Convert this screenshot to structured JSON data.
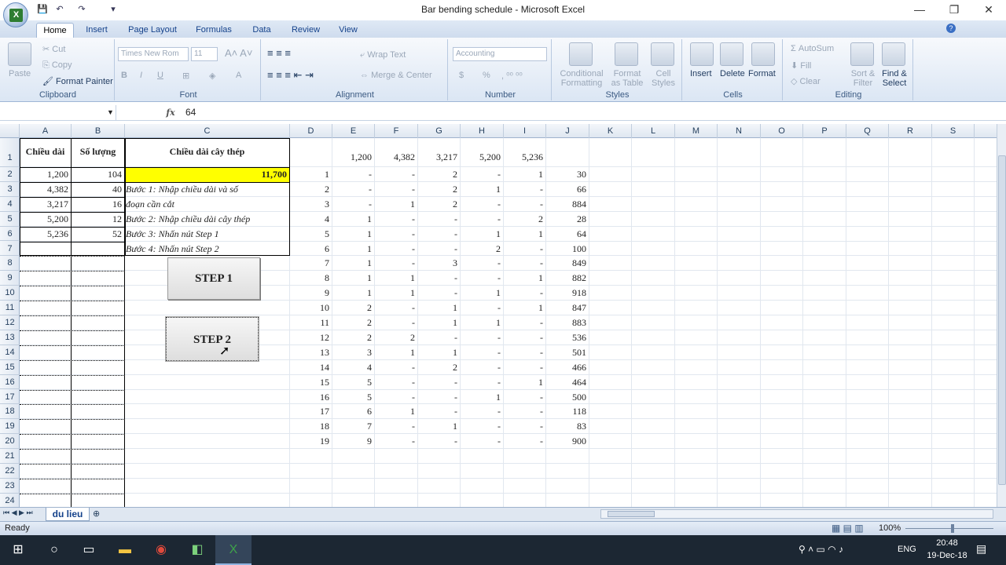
{
  "window": {
    "title": "Bar bending schedule - Microsoft Excel",
    "min": "—",
    "max": "❐",
    "close": "✕"
  },
  "qat": {
    "save": "💾",
    "undo": "↶",
    "redo": "↷",
    "more": "▾"
  },
  "tabs": [
    "Home",
    "Insert",
    "Page Layout",
    "Formulas",
    "Data",
    "Review",
    "View"
  ],
  "ribbon": {
    "clipboard": {
      "label": "Clipboard",
      "paste": "Paste",
      "cut": "Cut",
      "copy": "Copy",
      "format_painter": "Format Painter"
    },
    "font": {
      "label": "Font",
      "family": "Times New Rom",
      "size": "11"
    },
    "alignment": {
      "label": "Alignment",
      "wrap": "Wrap Text",
      "merge": "Merge & Center"
    },
    "number": {
      "label": "Number",
      "format": "Accounting",
      "currency": "$",
      "percent": "%"
    },
    "styles": {
      "label": "Styles",
      "conditional": "Conditional Formatting",
      "table": "Format as Table",
      "cell": "Cell Styles"
    },
    "cells": {
      "label": "Cells",
      "insert": "Insert",
      "delete": "Delete",
      "format": "Format"
    },
    "editing": {
      "label": "Editing",
      "autosum": "AutoSum",
      "fill": "Fill",
      "clear": "Clear",
      "sort": "Sort & Filter",
      "find": "Find & Select"
    }
  },
  "formula": {
    "namebox": "",
    "fx": "fx",
    "value": "64"
  },
  "columns": [
    "A",
    "B",
    "C",
    "D",
    "E",
    "F",
    "G",
    "H",
    "I",
    "J",
    "K",
    "L",
    "M",
    "N",
    "O",
    "P",
    "Q",
    "R",
    "S"
  ],
  "rows": [
    "1",
    "2",
    "3",
    "4",
    "5",
    "6",
    "7",
    "8",
    "9",
    "10",
    "11",
    "12",
    "13",
    "14",
    "15",
    "16",
    "17",
    "18",
    "19",
    "20",
    "21",
    "22",
    "23",
    "24"
  ],
  "left_table": {
    "header": [
      "Chiều dài",
      "Số lượng",
      "Chiều dài cây thép"
    ],
    "lengths": [
      "1,200",
      "4,382",
      "3,217",
      "5,200",
      "5,236"
    ],
    "qty": [
      "104",
      "40",
      "16",
      "12",
      "52"
    ],
    "bar_length": "11,700",
    "steps": [
      "Bước 1: Nhập chiều dài và số",
      "đoạn cần cắt",
      "Bước 2: Nhập chiều dài cây thép",
      "Bước 3: Nhấn nút Step 1",
      "Bước 4: Nhấn nút Step 2"
    ]
  },
  "buttons": {
    "step1": "STEP 1",
    "step2": "STEP 2"
  },
  "right_table": {
    "header": [
      "1,200",
      "4,382",
      "3,217",
      "5,200",
      "5,236"
    ],
    "rows": [
      [
        "1",
        "-",
        "-",
        "2",
        "-",
        "1",
        "30"
      ],
      [
        "2",
        "-",
        "-",
        "2",
        "1",
        "-",
        "66"
      ],
      [
        "3",
        "-",
        "1",
        "2",
        "-",
        "-",
        "884"
      ],
      [
        "4",
        "1",
        "-",
        "-",
        "-",
        "2",
        "28"
      ],
      [
        "5",
        "1",
        "-",
        "-",
        "1",
        "1",
        "64"
      ],
      [
        "6",
        "1",
        "-",
        "-",
        "2",
        "-",
        "100"
      ],
      [
        "7",
        "1",
        "-",
        "3",
        "-",
        "-",
        "849"
      ],
      [
        "8",
        "1",
        "1",
        "-",
        "-",
        "1",
        "882"
      ],
      [
        "9",
        "1",
        "1",
        "-",
        "1",
        "-",
        "918"
      ],
      [
        "10",
        "2",
        "-",
        "1",
        "-",
        "1",
        "847"
      ],
      [
        "11",
        "2",
        "-",
        "1",
        "1",
        "-",
        "883"
      ],
      [
        "12",
        "2",
        "2",
        "-",
        "-",
        "-",
        "536"
      ],
      [
        "13",
        "3",
        "1",
        "1",
        "-",
        "-",
        "501"
      ],
      [
        "14",
        "4",
        "-",
        "2",
        "-",
        "-",
        "466"
      ],
      [
        "15",
        "5",
        "-",
        "-",
        "-",
        "1",
        "464"
      ],
      [
        "16",
        "5",
        "-",
        "-",
        "1",
        "-",
        "500"
      ],
      [
        "17",
        "6",
        "1",
        "-",
        "-",
        "-",
        "118"
      ],
      [
        "18",
        "7",
        "-",
        "1",
        "-",
        "-",
        "83"
      ],
      [
        "19",
        "9",
        "-",
        "-",
        "-",
        "-",
        "900"
      ]
    ]
  },
  "sheet_tab": "du lieu",
  "status": {
    "ready": "Ready",
    "zoom": "100%"
  },
  "taskbar": {
    "lang": "ENG",
    "time": "20:48",
    "date": "19-Dec-18"
  }
}
